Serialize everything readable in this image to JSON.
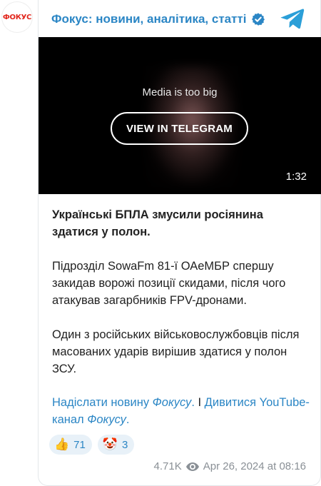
{
  "channel": {
    "avatar_text": "ФОКУС",
    "name": "Фокус: новини, аналітика, статті",
    "verified_icon": "verified-badge-icon",
    "telegram_icon": "telegram-logo-icon",
    "accent_color": "#2b86c5"
  },
  "media": {
    "message": "Media is too big",
    "button_label": "VIEW IN TELEGRAM",
    "duration": "1:32"
  },
  "post": {
    "headline": "Українські БПЛА змусили росіянина здатися у полон.",
    "paragraph_1": "Підрозділ SowaFm 81-ї ОАеМБР спершу закидав ворожі позиції скидами, після чого атакував загарбників FPV-дронами.",
    "paragraph_2": "Один з російських військовослужбовців після масованих ударів вирішив здатися у полон ЗСУ."
  },
  "links": {
    "send_news": "Надіслати новину ",
    "send_news_brand": "Фокусу",
    "send_news_end": ".",
    "separator": " I ",
    "youtube": "Дивитися YouTube-канал ",
    "youtube_brand": "Фокусу",
    "youtube_end": "."
  },
  "reactions": [
    {
      "emoji": "👍",
      "icon": "thumbs-up-icon",
      "count": "71"
    },
    {
      "emoji": "🤡",
      "icon": "clown-face-icon",
      "count": "3"
    }
  ],
  "meta": {
    "views": "4.71K",
    "views_icon": "eye-icon",
    "timestamp": "Apr 26, 2024 at 08:16"
  }
}
